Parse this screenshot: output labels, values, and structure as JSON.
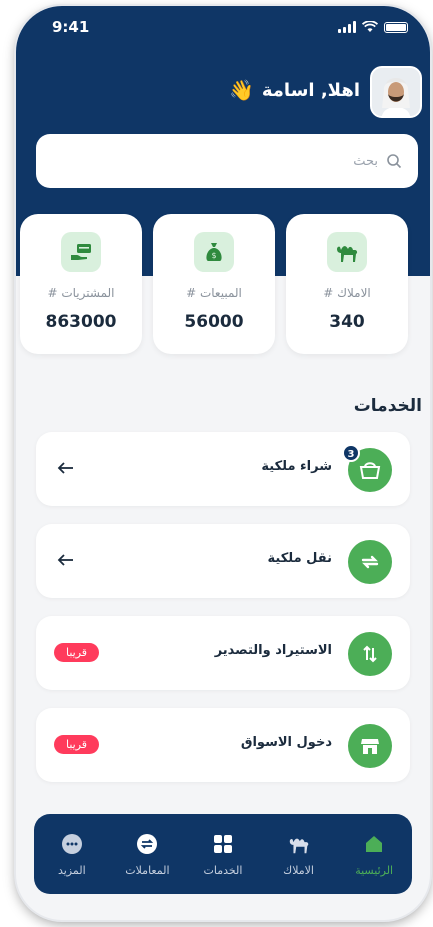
{
  "status": {
    "time": "9:41"
  },
  "header": {
    "greeting": "اهلا, اسامة",
    "wave": "👋"
  },
  "search": {
    "placeholder": "بحث"
  },
  "stats": [
    {
      "label": "# الاملاك",
      "value": "340",
      "icon": "camel-icon"
    },
    {
      "label": "# المبيعات",
      "value": "56000",
      "icon": "money-bag-icon"
    },
    {
      "label": "# المشتريات",
      "value": "863000",
      "icon": "hand-card-icon"
    }
  ],
  "services_title": "الخدمات",
  "services": [
    {
      "title": "شراء ملكية",
      "badge": "3",
      "icon": "basket-icon",
      "tag": ""
    },
    {
      "title": "نقل ملكية",
      "icon": "transfer-icon",
      "tag": ""
    },
    {
      "title": "الاستيراد والتصدير",
      "icon": "import-export-icon",
      "tag": "قريبا"
    },
    {
      "title": "دخول الاسواق",
      "icon": "store-icon",
      "tag": "قريبا"
    }
  ],
  "tabs": [
    {
      "label": "الرئيسية",
      "icon": "home-icon",
      "active": true
    },
    {
      "label": "الاملاك",
      "icon": "camel-icon"
    },
    {
      "label": "الخدمات",
      "icon": "grid-icon"
    },
    {
      "label": "المعاملات",
      "icon": "exchange-icon"
    },
    {
      "label": "المزيد",
      "icon": "more-icon"
    }
  ],
  "colors": {
    "primary": "#0f3666",
    "accent": "#4cae57",
    "soon": "#ff3b5c"
  }
}
